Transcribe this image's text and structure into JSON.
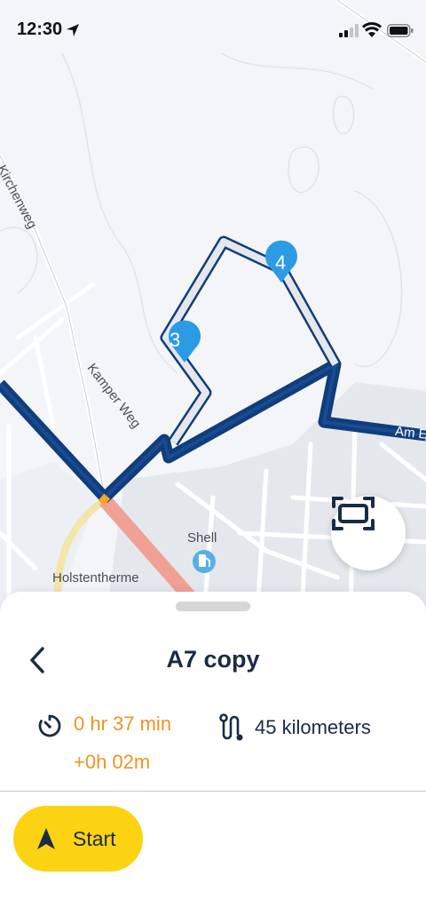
{
  "status_bar": {
    "time": "12:30"
  },
  "map": {
    "street_labels": [
      "Kirchenweg",
      "Kamper Weg",
      "Am E"
    ],
    "poi_labels": [
      "Shell",
      "Holstentherme"
    ],
    "waypoints": [
      "3",
      "4"
    ],
    "route_color": "#113d78",
    "traffic_color": "#f0a095"
  },
  "sheet": {
    "title": "A7 copy",
    "duration": "0 hr 37 min",
    "delay": "+0h 02m",
    "distance": "45 kilometers",
    "start_label": "Start",
    "accent_color": "#f0931f",
    "button_color": "#fcd313"
  },
  "icons": [
    "location-arrow-icon",
    "cellular-signal-icon",
    "wifi-icon",
    "battery-icon",
    "fit-route-icon",
    "back-chevron-icon",
    "timer-icon",
    "route-distance-icon",
    "navigation-arrow-icon",
    "gas-station-icon",
    "waypoint-pin-icon"
  ]
}
